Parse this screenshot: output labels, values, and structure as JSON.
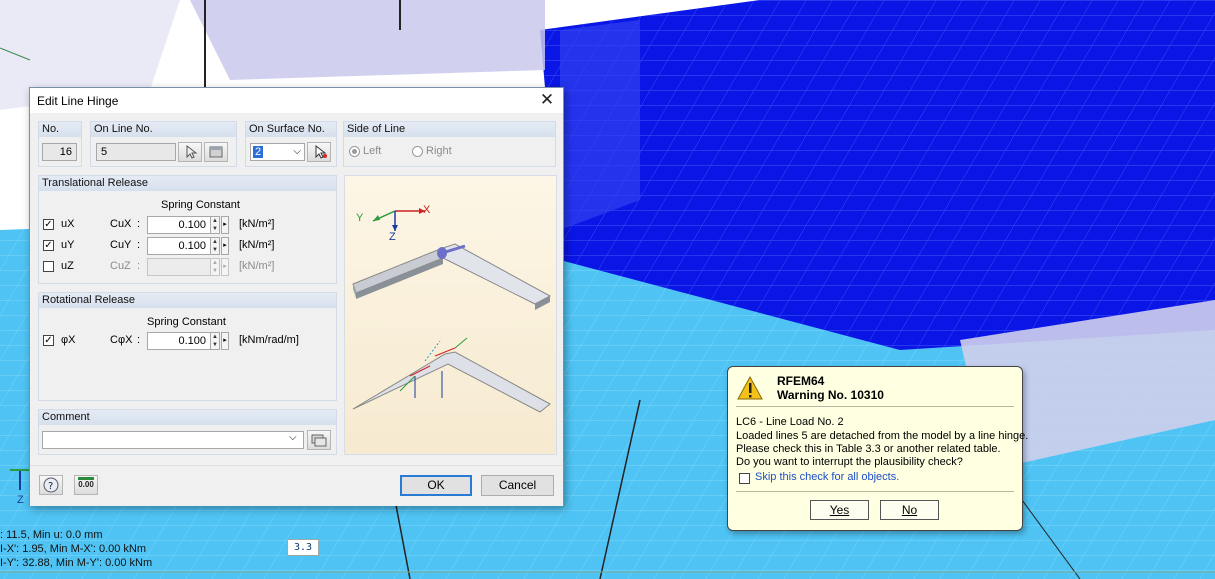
{
  "status_lines": [
    ": 11.5, Min u: 0.0 mm",
    "I-X': 1.95, Min M-X': 0.00 kNm",
    "I-Y': 32.88, Min M-Y': 0.00 kNm"
  ],
  "marker": "3.3",
  "axis_z_label": "Z",
  "dialog": {
    "title": "Edit Line Hinge",
    "close": "✕",
    "no_label": "No.",
    "no_value": "16",
    "on_line_label": "On Line No.",
    "on_line_value": "5",
    "on_surface_label": "On Surface No.",
    "on_surface_value": "2",
    "side_label": "Side of Line",
    "side_left": "Left",
    "side_right": "Right",
    "side_selected": "Left",
    "trans_header": "Translational Release",
    "rot_header": "Rotational Release",
    "spring_constant": "Spring Constant",
    "rows": [
      {
        "dof": "uX",
        "checked": true,
        "const": "CuX",
        "value": "0.100",
        "unit": "[kN/m²]"
      },
      {
        "dof": "uY",
        "checked": true,
        "const": "CuY",
        "value": "0.100",
        "unit": "[kN/m²]"
      },
      {
        "dof": "uZ",
        "checked": false,
        "const": "CuZ",
        "value": "",
        "unit": "[kN/m²]"
      }
    ],
    "rot_row": {
      "dof": "φX",
      "checked": true,
      "const": "CφX",
      "value": "0.100",
      "unit": "[kNm/rad/m]"
    },
    "colon": ":",
    "comment_label": "Comment",
    "comment_value": "",
    "ok": "OK",
    "cancel": "Cancel",
    "help_icon": "help-icon",
    "units_icon_text": "0.00"
  },
  "warning": {
    "title": "RFEM64",
    "subtitle": "Warning No. 10310",
    "line1": "LC6 - Line Load No. 2",
    "line2": "Loaded lines 5 are detached from the model by a line hinge.",
    "line3": "Please check this in Table 3.3 or another related table.",
    "line4": "Do you want to interrupt the plausibility check?",
    "skip": "Skip this check for all objects.",
    "yes": "Yes",
    "no": "No"
  },
  "diagram_labels": {
    "x": "X",
    "y": "Y",
    "z": "Z"
  }
}
